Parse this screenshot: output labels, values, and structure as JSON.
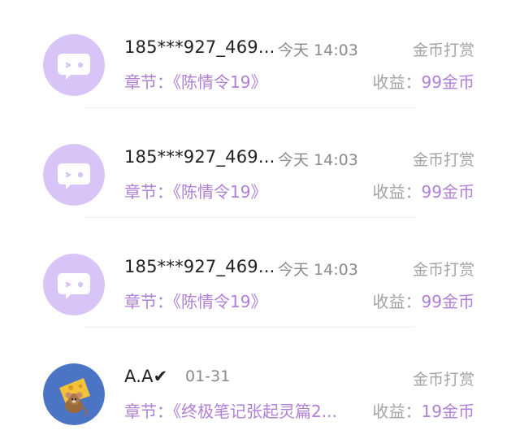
{
  "records": [
    {
      "user": "185***927_469...",
      "time": "今天 14:03",
      "type": "金币打赏",
      "chapter": "章节：《陈情令19》",
      "earn_label": "收益：",
      "earn_value": "99金币",
      "avatar_icon": "chat-bubble-wink-icon"
    },
    {
      "user": "185***927_469...",
      "time": "今天 14:03",
      "type": "金币打赏",
      "chapter": "章节：《陈情令19》",
      "earn_label": "收益：",
      "earn_value": "99金币",
      "avatar_icon": "chat-bubble-wink-icon"
    },
    {
      "user": "185***927_469...",
      "time": "今天 14:03",
      "type": "金币打赏",
      "chapter": "章节：《陈情令19》",
      "earn_label": "收益：",
      "earn_value": "99金币",
      "avatar_icon": "chat-bubble-wink-icon"
    },
    {
      "user": "A.A✔",
      "time": "01-31",
      "type": "金币打赏",
      "chapter": "章节：《终极笔记张起灵篇2...",
      "earn_label": "收益：",
      "earn_value": "19金币",
      "avatar_icon": "cartoon-mouse-avatar"
    }
  ],
  "colors": {
    "accent": "#b07fd6",
    "avatar_bg": "#d8c4f6",
    "avatar_blue": "#4c74c4"
  }
}
